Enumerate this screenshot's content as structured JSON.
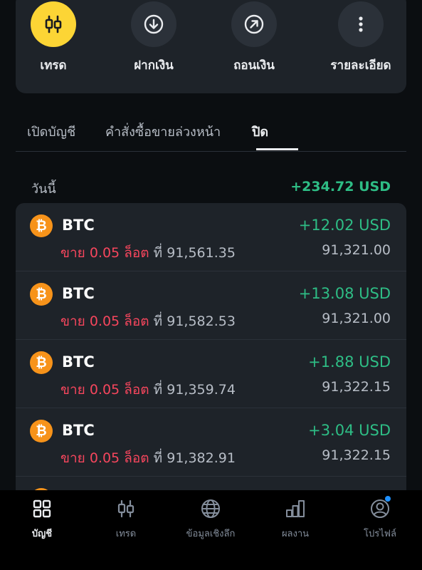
{
  "actions": [
    {
      "label": "เทรด",
      "icon": "candlestick-icon"
    },
    {
      "label": "ฝากเงิน",
      "icon": "deposit-icon"
    },
    {
      "label": "ถอนเงิน",
      "icon": "withdraw-icon"
    },
    {
      "label": "รายละเอียด",
      "icon": "more-vertical-icon"
    }
  ],
  "tabs": [
    {
      "label": "เปิดบัญชี"
    },
    {
      "label": "คำสั่งซื้อขายล่วงหน้า"
    },
    {
      "label": "ปิด",
      "active": true
    }
  ],
  "summary": {
    "label": "วันนี้",
    "total": "+234.72 USD"
  },
  "trades": [
    {
      "symbol": "BTC",
      "side": "ขาย",
      "lots": "0.05",
      "lot_unit": "ล็อต",
      "at": "ที่",
      "open_price": "91,561.35",
      "pnl": "+12.02 USD",
      "close_price": "91,321.00"
    },
    {
      "symbol": "BTC",
      "side": "ขาย",
      "lots": "0.05",
      "lot_unit": "ล็อต",
      "at": "ที่",
      "open_price": "91,582.53",
      "pnl": "+13.08 USD",
      "close_price": "91,321.00"
    },
    {
      "symbol": "BTC",
      "side": "ขาย",
      "lots": "0.05",
      "lot_unit": "ล็อต",
      "at": "ที่",
      "open_price": "91,359.74",
      "pnl": "+1.88 USD",
      "close_price": "91,322.15"
    },
    {
      "symbol": "BTC",
      "side": "ขาย",
      "lots": "0.05",
      "lot_unit": "ล็อต",
      "at": "ที่",
      "open_price": "91,382.91",
      "pnl": "+3.04 USD",
      "close_price": "91,322.15"
    }
  ],
  "coin_glyph": "₿",
  "nav": [
    {
      "label": "บัญชี",
      "icon": "grid-icon",
      "active": true
    },
    {
      "label": "เทรด",
      "icon": "candlestick-icon"
    },
    {
      "label": "ข้อมูลเชิงลึก",
      "icon": "globe-icon"
    },
    {
      "label": "ผลงาน",
      "icon": "bar-chart-icon"
    },
    {
      "label": "โปรไฟล์",
      "icon": "profile-icon"
    }
  ],
  "colors": {
    "profit": "#2ebd85",
    "sell": "#f6465d",
    "accent": "#fcd535",
    "card": "#1e2329",
    "background": "#0b0e11"
  }
}
